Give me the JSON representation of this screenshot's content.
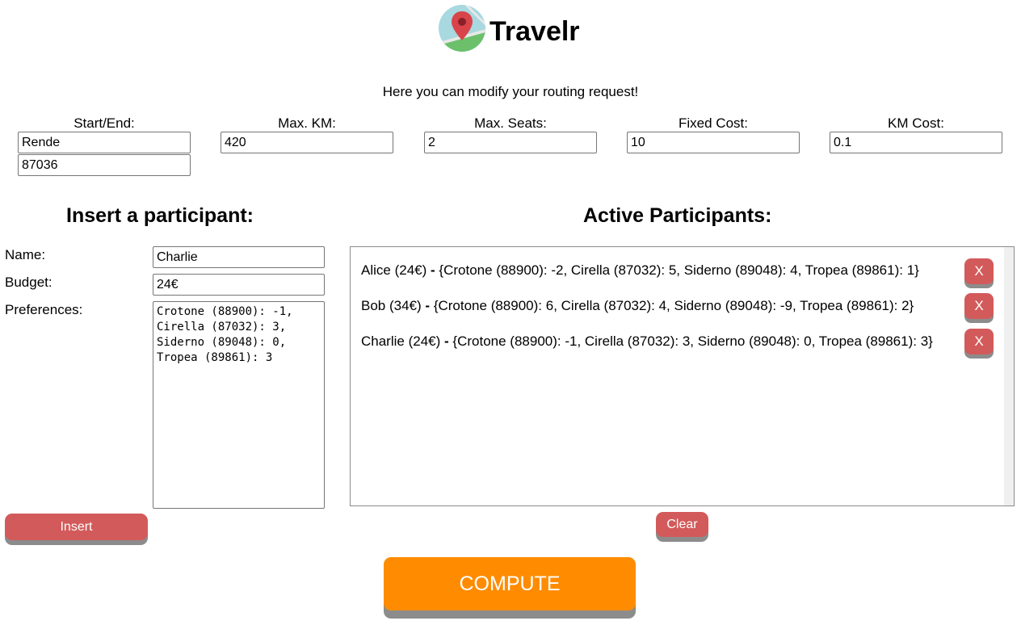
{
  "header": {
    "app_title": "Travelr",
    "logo_icon": "map-pin-icon",
    "subtitle": "Here you can modify your routing request!"
  },
  "routing": {
    "start_end": {
      "label": "Start/End:",
      "city": "Rende",
      "zip": "87036"
    },
    "max_km": {
      "label": "Max. KM:",
      "value": "420"
    },
    "max_seats": {
      "label": "Max. Seats:",
      "value": "2"
    },
    "fixed_cost": {
      "label": "Fixed Cost:",
      "value": "10"
    },
    "km_cost": {
      "label": "KM Cost:",
      "value": "0.1"
    }
  },
  "insert_form": {
    "heading": "Insert a participant:",
    "name_label": "Name:",
    "name_value": "Charlie",
    "budget_label": "Budget:",
    "budget_value": "24€",
    "preferences_label": "Preferences:",
    "preferences_value": "Crotone (88900): -1,\nCirella (87032): 3,\nSiderno (89048): 0,\nTropea (89861): 3",
    "insert_button": "Insert"
  },
  "active": {
    "heading": "Active Participants:",
    "participants": [
      {
        "name": "Alice",
        "budget": "(24€)",
        "prefs": "{Crotone (88900): -2, Cirella (87032): 5, Siderno (89048): 4, Tropea (89861): 1}",
        "remove_label": "X"
      },
      {
        "name": "Bob",
        "budget": "(34€)",
        "prefs": "{Crotone (88900): 6, Cirella (87032): 4, Siderno (89048): -9, Tropea (89861): 2}",
        "remove_label": "X"
      },
      {
        "name": "Charlie",
        "budget": "(24€)",
        "prefs": "{Crotone (88900): -1, Cirella (87032): 3, Siderno (89048): 0, Tropea (89861): 3}",
        "remove_label": "X"
      }
    ],
    "separator": "-",
    "clear_button": "Clear"
  },
  "compute_button": "COMPUTE",
  "colors": {
    "accent_red": "#d35a5a",
    "compute_orange": "#ff8c00",
    "button_shadow": "#8c8c8c"
  }
}
